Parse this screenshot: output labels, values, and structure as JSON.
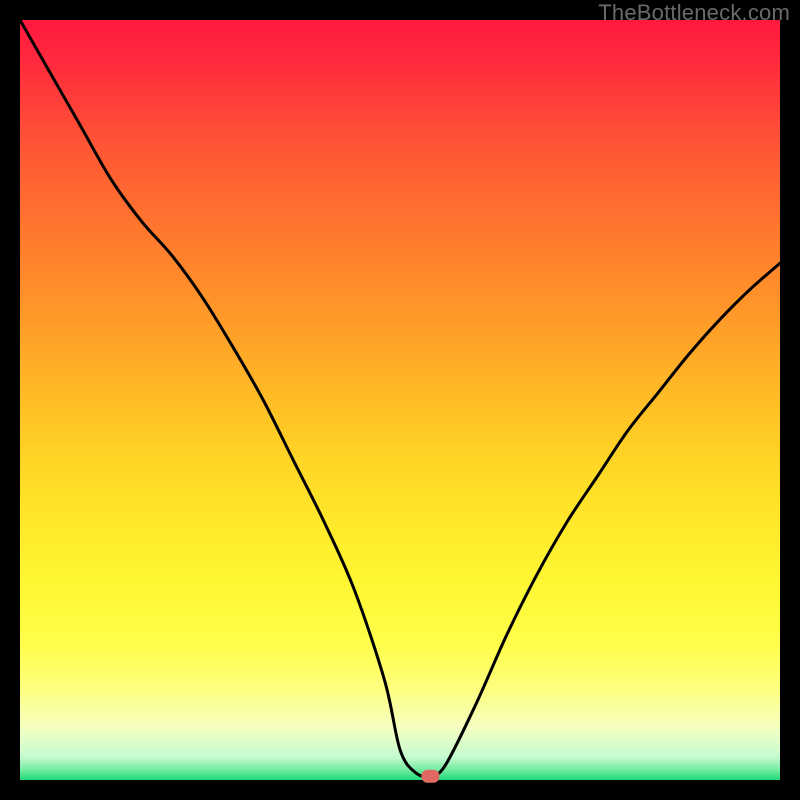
{
  "watermark": "TheBottleneck.com",
  "chart_data": {
    "type": "line",
    "title": "",
    "xlabel": "",
    "ylabel": "",
    "xlim": [
      0,
      100
    ],
    "ylim": [
      0,
      100
    ],
    "grid": false,
    "series": [
      {
        "name": "bottleneck-curve",
        "color": "#000000",
        "x": [
          0,
          4,
          8,
          12,
          16,
          20,
          24,
          28,
          32,
          36,
          40,
          44,
          48,
          50,
          52,
          54,
          56,
          60,
          64,
          68,
          72,
          76,
          80,
          84,
          88,
          92,
          96,
          100
        ],
        "y": [
          100,
          93,
          86,
          79,
          73.5,
          69,
          63.5,
          57,
          50,
          42,
          34,
          25,
          13,
          4,
          1,
          0.5,
          2,
          10,
          19,
          27,
          34,
          40,
          46,
          51,
          56,
          60.5,
          64.5,
          68
        ]
      }
    ],
    "marker": {
      "x": 54,
      "y": 0.5,
      "color": "#e06a62"
    },
    "gradient_stops": [
      {
        "pct": 0,
        "color": "#ff183f"
      },
      {
        "pct": 6,
        "color": "#ff2c3d"
      },
      {
        "pct": 12,
        "color": "#ff4438"
      },
      {
        "pct": 18,
        "color": "#ff5a34"
      },
      {
        "pct": 26,
        "color": "#ff722f"
      },
      {
        "pct": 34,
        "color": "#ff8a2b"
      },
      {
        "pct": 42,
        "color": "#ffa328"
      },
      {
        "pct": 50,
        "color": "#ffbd26"
      },
      {
        "pct": 58,
        "color": "#ffd526"
      },
      {
        "pct": 66,
        "color": "#ffe82a"
      },
      {
        "pct": 74,
        "color": "#fff733"
      },
      {
        "pct": 82,
        "color": "#fffe4a"
      },
      {
        "pct": 88,
        "color": "#feff7e"
      },
      {
        "pct": 93,
        "color": "#f6ffc0"
      },
      {
        "pct": 97,
        "color": "#c5fbd0"
      },
      {
        "pct": 99,
        "color": "#61e896"
      },
      {
        "pct": 100,
        "color": "#1bd97b"
      }
    ]
  }
}
